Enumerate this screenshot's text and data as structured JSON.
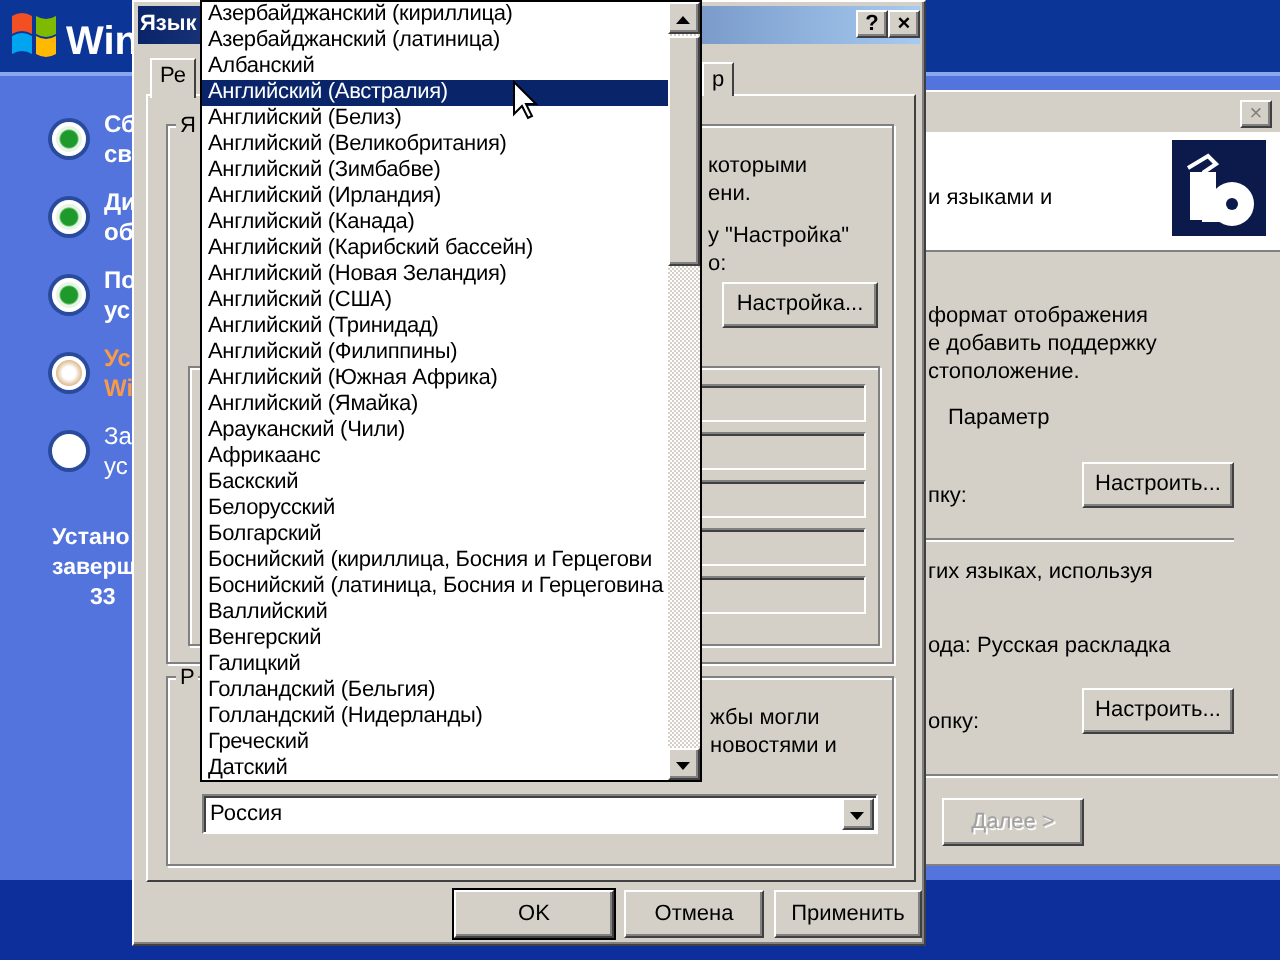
{
  "logo": {
    "text": "Win"
  },
  "setup_steps": [
    {
      "lines": [
        "Сб",
        "св"
      ],
      "kind": "done"
    },
    {
      "lines": [
        "Ди",
        "об"
      ],
      "kind": "done"
    },
    {
      "lines": [
        "По",
        "ус"
      ],
      "kind": "done"
    },
    {
      "lines": [
        "Ус",
        "Wi"
      ],
      "kind": "current"
    },
    {
      "lines": [
        "За",
        "ус"
      ],
      "kind": "pending"
    }
  ],
  "time_remaining": [
    "Устано",
    "заверш",
    "33"
  ],
  "wizard_window": {
    "close": "×",
    "header_text": "и языками и",
    "body_lines": [
      "формат отображения",
      "е добавить поддержку",
      "стоположение."
    ],
    "option_label": "Параметр",
    "rows": [
      {
        "label": "пку:",
        "button": "Настроить..."
      },
      {
        "label": "гих языках, используя"
      },
      {
        "label": "ода: Русская раскладка"
      },
      {
        "label": "опку:",
        "button": "Настроить..."
      }
    ],
    "next_button": {
      "label": "Далее >",
      "disabled": true
    }
  },
  "dialog": {
    "title": "Язык",
    "title_buttons": [
      "?",
      "×"
    ],
    "tabs": [
      {
        "label": "Ре",
        "selected": true
      },
      {
        "label": "р",
        "selected": false
      }
    ],
    "group1": {
      "label": "Я",
      "lines": [
        "которыми",
        "ени.",
        "у \"Настройка\"",
        "о:"
      ],
      "button": "Настройка...",
      "sample_fields": [
        {
          "disabled": true
        },
        {
          "disabled": true
        },
        {
          "disabled": true
        },
        {
          "disabled": true
        },
        {
          "disabled": true
        }
      ]
    },
    "group2": {
      "label": "Р",
      "lines": [
        "жбы могли",
        "новостями и"
      ],
      "location": {
        "value": "Россия"
      }
    },
    "language_list": {
      "items": [
        {
          "label": "Азербайджанский (кириллица)",
          "selected": false
        },
        {
          "label": "Азербайджанский (латиница)",
          "selected": false
        },
        {
          "label": "Албанский",
          "selected": false
        },
        {
          "label": "Английский (Австралия)",
          "selected": true
        },
        {
          "label": "Английский (Белиз)",
          "selected": false
        },
        {
          "label": "Английский (Великобритания)",
          "selected": false
        },
        {
          "label": "Английский (Зимбабве)",
          "selected": false
        },
        {
          "label": "Английский (Ирландия)",
          "selected": false
        },
        {
          "label": "Английский (Канада)",
          "selected": false
        },
        {
          "label": "Английский (Карибский бассейн)",
          "selected": false
        },
        {
          "label": "Английский (Новая Зеландия)",
          "selected": false
        },
        {
          "label": "Английский (США)",
          "selected": false
        },
        {
          "label": "Английский (Тринидад)",
          "selected": false
        },
        {
          "label": "Английский (Филиппины)",
          "selected": false
        },
        {
          "label": "Английский (Южная Африка)",
          "selected": false
        },
        {
          "label": "Английский (Ямайка)",
          "selected": false
        },
        {
          "label": "Арауканский (Чили)",
          "selected": false
        },
        {
          "label": "Африкаанс",
          "selected": false
        },
        {
          "label": "Баскский",
          "selected": false
        },
        {
          "label": "Белорусский",
          "selected": false
        },
        {
          "label": "Болгарский",
          "selected": false
        },
        {
          "label": "Боснийский (кириллица, Босния и Герцегови",
          "selected": false
        },
        {
          "label": "Боснийский (латиница, Босния и Герцеговина",
          "selected": false
        },
        {
          "label": "Валлийский",
          "selected": false
        },
        {
          "label": "Венгерский",
          "selected": false
        },
        {
          "label": "Галицкий",
          "selected": false
        },
        {
          "label": "Голландский (Бельгия)",
          "selected": false
        },
        {
          "label": "Голландский (Нидерланды)",
          "selected": false
        },
        {
          "label": "Греческий",
          "selected": false
        },
        {
          "label": "Датский",
          "selected": false
        }
      ]
    },
    "buttons": [
      "OK",
      "Отмена",
      "Применить"
    ]
  }
}
